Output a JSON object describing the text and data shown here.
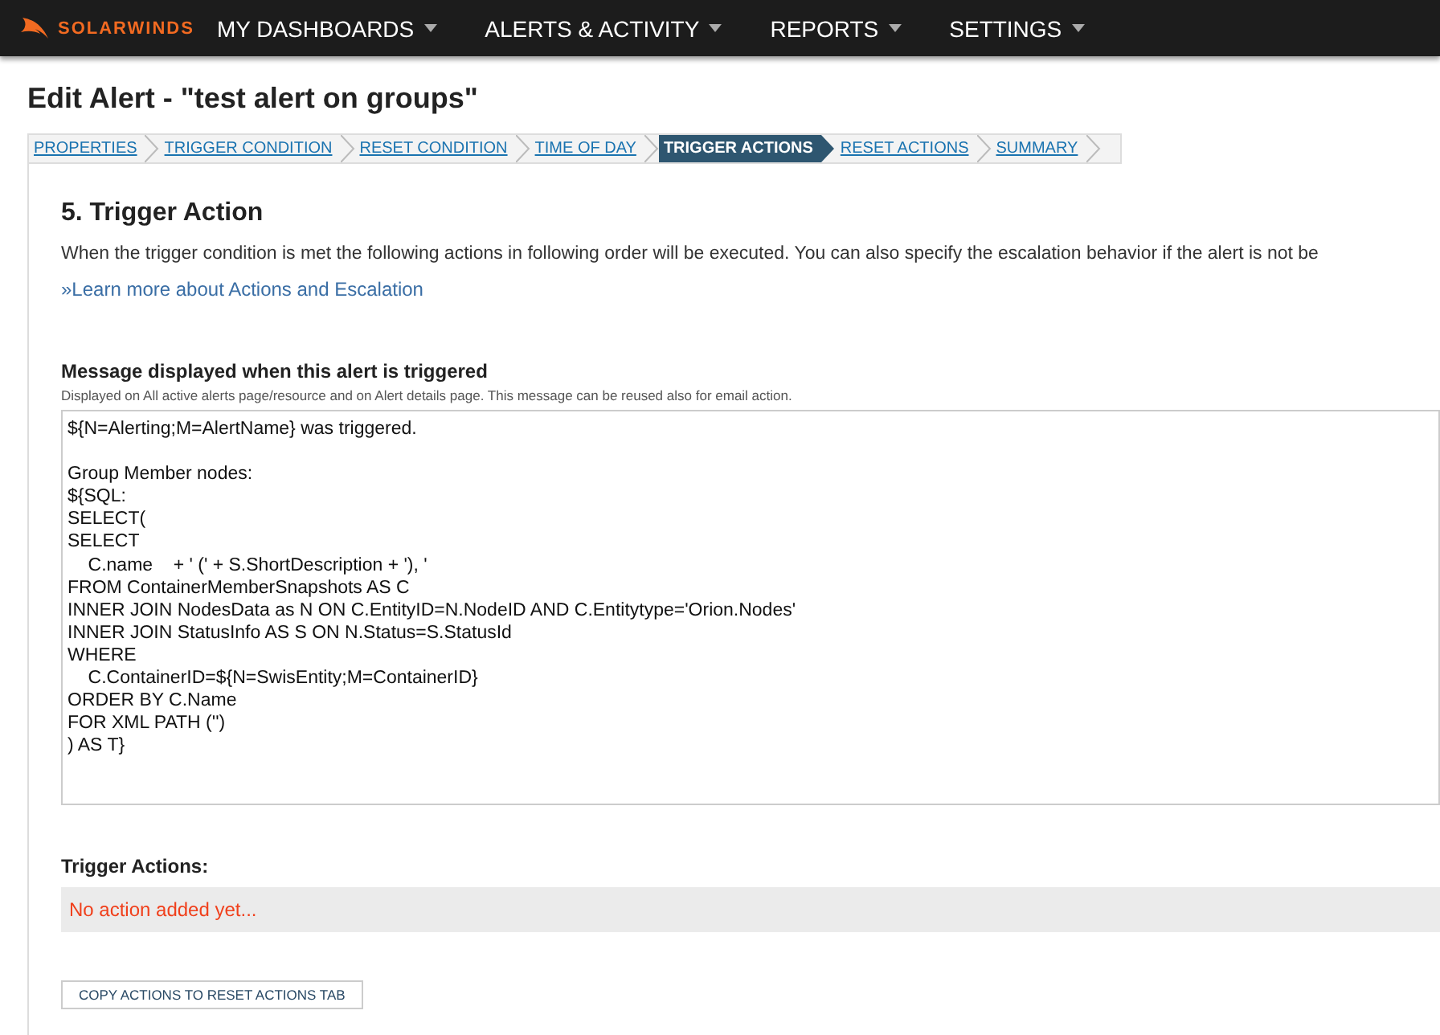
{
  "topbar": {
    "brand": "SOLARWINDS",
    "menu": [
      {
        "label": "MY DASHBOARDS"
      },
      {
        "label": "ALERTS & ACTIVITY"
      },
      {
        "label": "REPORTS"
      },
      {
        "label": "SETTINGS"
      }
    ]
  },
  "page_title": "Edit Alert - \"test alert on groups\"",
  "steps": [
    {
      "label": "PROPERTIES",
      "selected": false
    },
    {
      "label": "TRIGGER CONDITION",
      "selected": false
    },
    {
      "label": "RESET CONDITION",
      "selected": false
    },
    {
      "label": "TIME OF DAY",
      "selected": false
    },
    {
      "label": "TRIGGER ACTIONS",
      "selected": true
    },
    {
      "label": "RESET ACTIONS",
      "selected": false
    },
    {
      "label": "SUMMARY",
      "selected": false
    }
  ],
  "section": {
    "heading": "5. Trigger Action",
    "description": "When the trigger condition is met the following actions in following order will be executed. You can also specify the escalation behavior if the alert is not be",
    "link": "»Learn more about Actions and Escalation"
  },
  "message": {
    "label": "Message displayed when this alert is triggered",
    "hint": "Displayed on All active alerts page/resource and on Alert details page. This message can be reused also for email action.",
    "value": [
      "${N=Alerting;M=AlertName} was triggered.\n\nGroup Member nodes:",
      "${SQL:",
      "SELECT(",
      "SELECT",
      "\tC.name    + ' (' + S.ShortDescription + '), '",
      "FROM ContainerMemberSnapshots AS C",
      "INNER JOIN NodesData as N ON C.EntityID=N.NodeID AND C.Entitytype='Orion.Nodes'",
      "INNER JOIN StatusInfo AS S ON N.Status=S.StatusId",
      "WHERE",
      "\tC.ContainerID=${N=SwisEntity;M=ContainerID}",
      "ORDER BY C.Name",
      "FOR XML PATH ('')",
      ") AS T}"
    ]
  },
  "trigger_actions": {
    "label": "Trigger Actions:",
    "empty_text": "No action added yet..."
  },
  "copy_button": "COPY ACTIONS TO RESET ACTIONS TAB"
}
